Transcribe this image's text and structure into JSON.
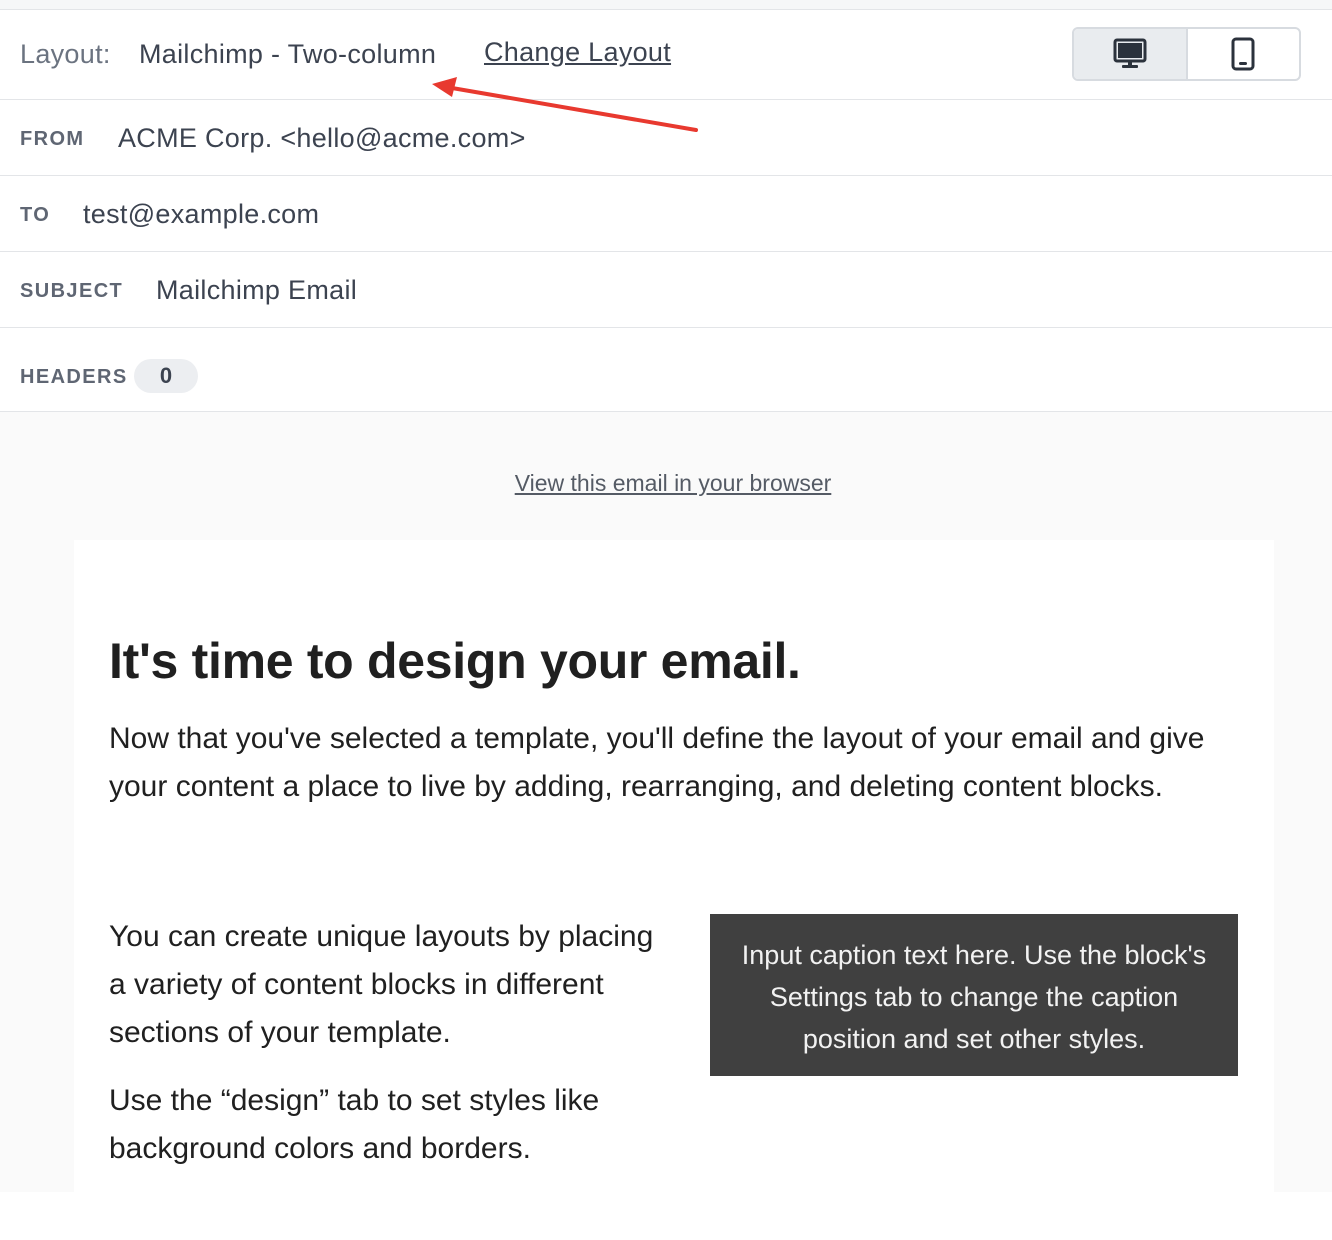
{
  "layout_row": {
    "label": "Layout:",
    "value": "Mailchimp - Two-column",
    "change_link": "Change Layout",
    "devices": [
      "desktop-icon",
      "mobile-icon"
    ],
    "active_device": "desktop"
  },
  "from": {
    "label": "FROM",
    "value": "ACME Corp. <hello@acme.com>"
  },
  "to": {
    "label": "TO",
    "value": "test@example.com"
  },
  "subject": {
    "label": "SUBJECT",
    "value": "Mailchimp Email"
  },
  "headers": {
    "label": "HEADERS",
    "count": "0"
  },
  "preview": {
    "view_in_browser": "View this email in your browser",
    "heading": "It's time to design your email.",
    "intro": "Now that you've selected a template, you'll define the layout of your email and give your content a place to live by adding, rearranging, and deleting content blocks.",
    "left_p1": "You can create unique layouts by placing a variety of content blocks in different sections of your template.",
    "left_p2": "Use the “design” tab to set styles like background colors and borders.",
    "caption": "Input caption text here. Use the block's Settings tab to change the caption position and set other styles."
  },
  "colors": {
    "annotation_arrow": "#e8392f",
    "caption_bg": "#404040",
    "preview_bg": "#fafafa"
  }
}
